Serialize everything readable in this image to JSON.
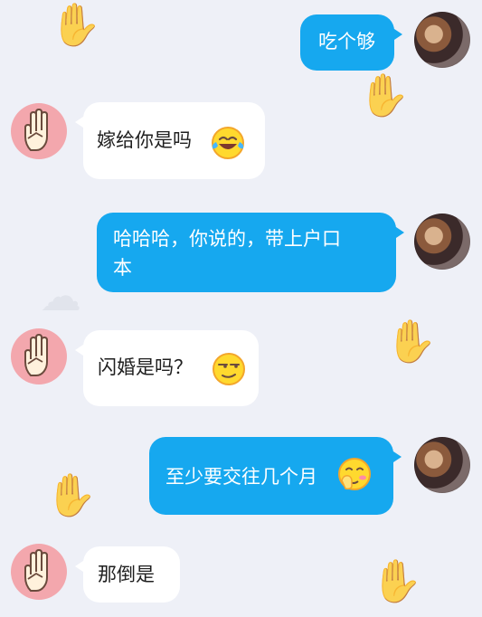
{
  "chat": {
    "messages": [
      {
        "sender": "self",
        "text": "吃个够"
      },
      {
        "sender": "other",
        "text": "嫁给你是吗",
        "emoji": "laughing-tears-face-icon"
      },
      {
        "sender": "self",
        "text": "哈哈哈，你说的，带上户口\n本"
      },
      {
        "sender": "other",
        "text": "闪婚是吗？",
        "emoji": "smirking-face-icon"
      },
      {
        "sender": "self",
        "text": "至少要交往几个月",
        "emoji": "shy-face-icon"
      },
      {
        "sender": "other",
        "text": "那倒是"
      }
    ]
  },
  "colors": {
    "self_bubble": "#16a8ef",
    "other_bubble": "#ffffff",
    "background": "#eef0f7",
    "avatar_other": "#f3a7ad"
  }
}
